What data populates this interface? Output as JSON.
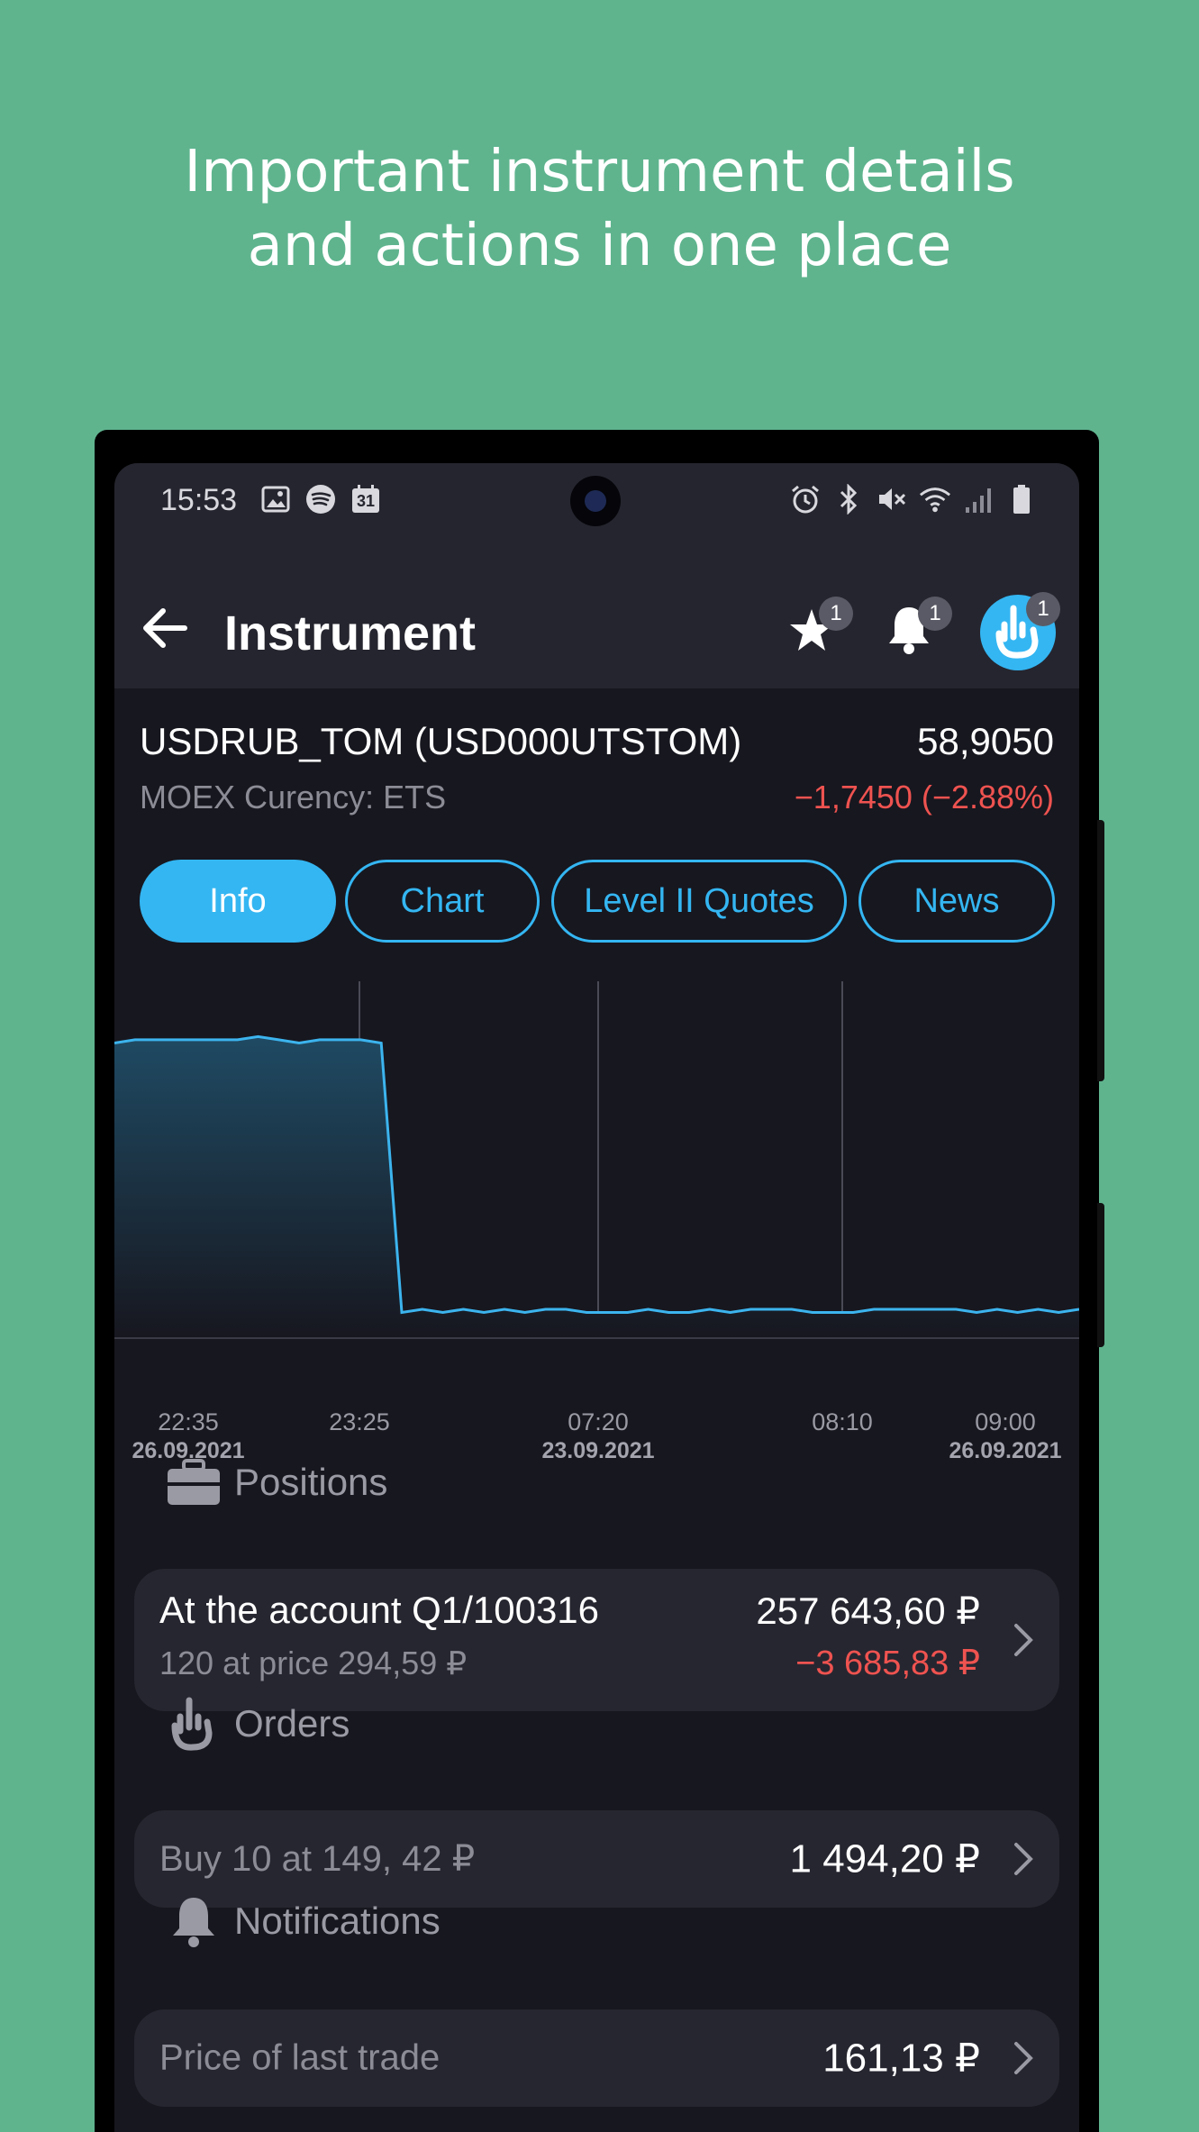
{
  "headline": {
    "line1": "Important instrument details",
    "line2": "and actions in one place"
  },
  "status_bar": {
    "time": "15:53",
    "calendar_day": "31",
    "left_icons": [
      "gallery-icon",
      "spotify-icon",
      "calendar-icon"
    ],
    "right_icons": [
      "alarm-icon",
      "bluetooth-icon",
      "mute-icon",
      "wifi-icon",
      "signal-icon",
      "battery-icon"
    ]
  },
  "header": {
    "title": "Instrument",
    "favorites_badge": "1",
    "alerts_badge": "1",
    "orders_badge": "1"
  },
  "instrument": {
    "name": "USDRUB_TOM (USD000UTSTOM)",
    "price": "58,9050",
    "exchange": "MOEX Curency: ETS",
    "change": "−1,7450 (−2.88%)"
  },
  "tabs": [
    {
      "label": "Info",
      "active": true
    },
    {
      "label": "Chart",
      "active": false
    },
    {
      "label": "Level II Quotes",
      "active": false
    },
    {
      "label": "News",
      "active": false
    }
  ],
  "chart_data": {
    "type": "area",
    "x_ticks": [
      {
        "time": "22:35",
        "date": "26.09.2021"
      },
      {
        "time": "23:25",
        "date": ""
      },
      {
        "time": "07:20",
        "date": "23.09.2021"
      },
      {
        "time": "08:10",
        "date": ""
      },
      {
        "time": "09:00",
        "date": "26.09.2021"
      }
    ],
    "points": [
      0.92,
      0.93,
      0.93,
      0.93,
      0.93,
      0.93,
      0.93,
      0.94,
      0.93,
      0.92,
      0.93,
      0.93,
      0.93,
      0.92,
      0.08,
      0.09,
      0.08,
      0.09,
      0.08,
      0.09,
      0.08,
      0.09,
      0.09,
      0.08,
      0.08,
      0.08,
      0.09,
      0.08,
      0.08,
      0.09,
      0.08,
      0.09,
      0.09,
      0.09,
      0.08,
      0.08,
      0.08,
      0.09,
      0.09,
      0.09,
      0.09,
      0.09,
      0.08,
      0.09,
      0.08,
      0.09,
      0.08,
      0.09
    ],
    "colors": {
      "line": "#3cb4ee",
      "fill_top": "#1f4a63",
      "fill_bottom": "#17171f"
    }
  },
  "positions": {
    "title": "Positions",
    "account": "At the account Q1/100316",
    "details": "120 at price 294,59 ₽",
    "value": "257 643,60 ₽",
    "pnl": "−3 685,83 ₽"
  },
  "orders": {
    "title": "Orders",
    "description": "Buy 10 at 149, 42 ₽",
    "value": "1 494,20 ₽"
  },
  "notifications": {
    "title": "Notifications",
    "description": "Price of last trade",
    "value": "161,13 ₽"
  },
  "colors": {
    "background": "#5fb48e",
    "accent": "#34b6f2",
    "negative": "#ef5350",
    "surface": "#262630"
  }
}
